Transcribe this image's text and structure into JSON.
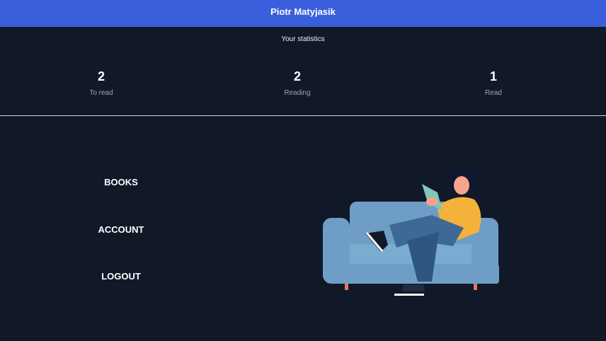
{
  "header": {
    "username": "Piotr Matyjasik",
    "color": "#3b5fdc"
  },
  "stats": {
    "title": "Your statistics",
    "items": [
      {
        "value": "2",
        "label": "To read"
      },
      {
        "value": "2",
        "label": "Reading"
      },
      {
        "value": "1",
        "label": "Read"
      }
    ]
  },
  "menu": {
    "items": [
      {
        "label": "BOOKS"
      },
      {
        "label": "ACCOUNT"
      },
      {
        "label": "LOGOUT"
      }
    ]
  },
  "illustration": {
    "icon": "person-reading-on-sofa-illustration"
  },
  "colors": {
    "background": "#111827",
    "accent": "#3b5fdc"
  }
}
